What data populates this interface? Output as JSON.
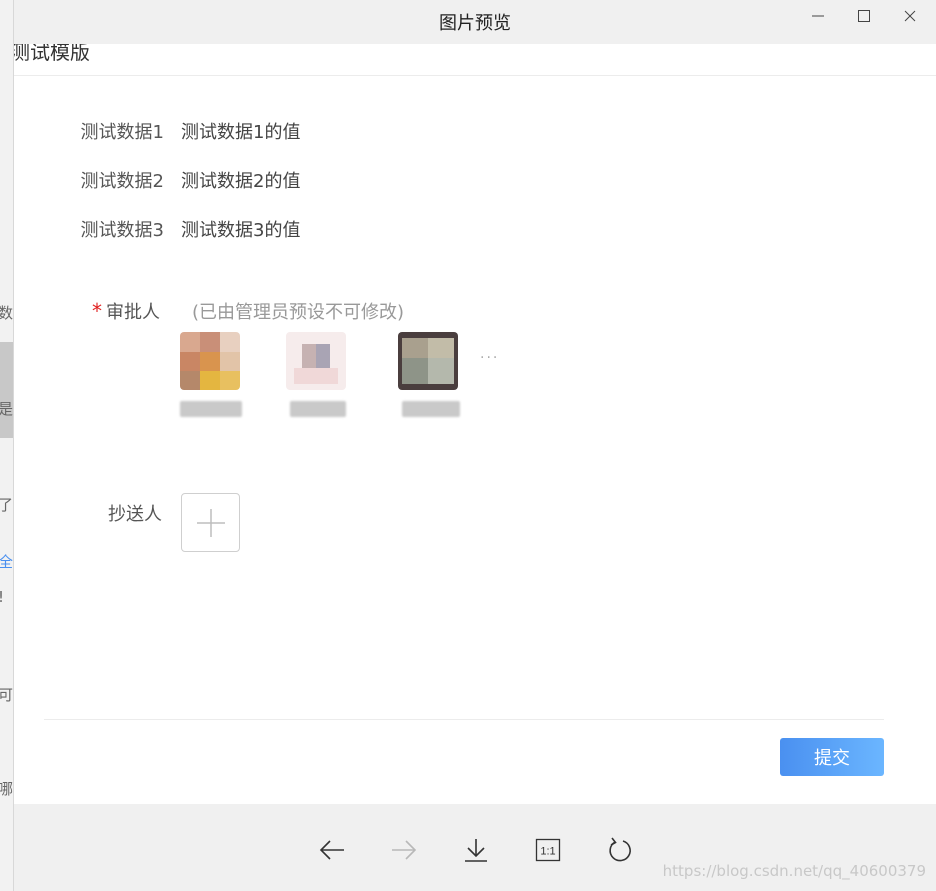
{
  "window": {
    "title": "图片预览",
    "controls": {
      "minimize": "—",
      "maximize": "□",
      "close": "✕"
    }
  },
  "background_fragments": [
    "数",
    "是",
    "了",
    "全",
    "!",
    "可",
    "哪"
  ],
  "document": {
    "title": "测试模版",
    "fields": [
      {
        "label": "测试数据1",
        "value": "测试数据1的值"
      },
      {
        "label": "测试数据2",
        "value": "测试数据2的值"
      },
      {
        "label": "测试数据3",
        "value": "测试数据3的值"
      }
    ],
    "approver": {
      "required_mark": "*",
      "label": "审批人",
      "note": "(已由管理员预设不可修改)",
      "more": "···"
    },
    "cc": {
      "label": "抄送人"
    },
    "submit_label": "提交"
  },
  "toolbar": {
    "tools": [
      "arrow-left-icon",
      "arrow-right-icon",
      "download-icon",
      "actual-size-icon",
      "rotate-icon"
    ],
    "actual_size_label": "1:1"
  },
  "watermark": "https://blog.csdn.net/qq_40600379",
  "colors": {
    "accent": "#4a90f0",
    "required": "#e02020",
    "muted_text": "#999999"
  }
}
